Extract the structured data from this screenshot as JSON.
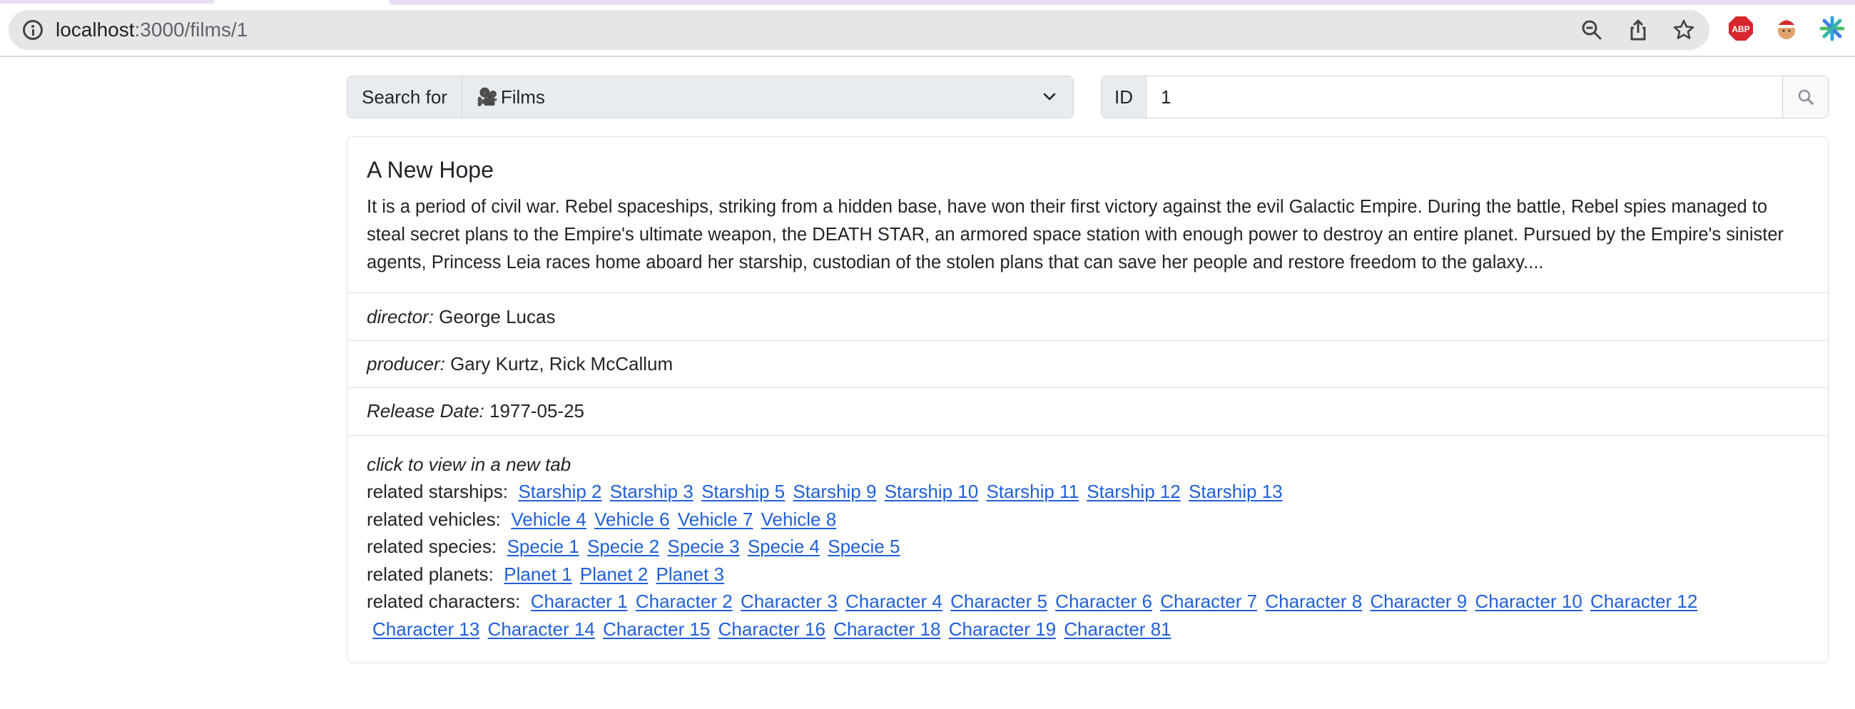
{
  "browser": {
    "url_host": "localhost",
    "url_path": ":3000/films/1",
    "extensions": [
      "abp-extension-icon",
      "santa-extension-icon",
      "sparkle-extension-icon"
    ],
    "ext_abp_label": "ABP"
  },
  "search": {
    "search_for_label": "Search for",
    "category_icon": "🎥",
    "category_value": "Films",
    "id_label": "ID",
    "id_value": "1"
  },
  "film": {
    "title": "A New Hope",
    "opening_crawl": "It is a period of civil war. Rebel spaceships, striking from a hidden base, have won their first victory against the evil Galactic Empire. During the battle, Rebel spies managed to steal secret plans to the Empire's ultimate weapon, the DEATH STAR, an armored space station with enough power to destroy an entire planet. Pursued by the Empire's sinister agents, Princess Leia races home aboard her starship, custodian of the stolen plans that can save her people and restore freedom to the galaxy....",
    "director_label": "director:",
    "director": "George Lucas",
    "producer_label": "producer:",
    "producer": "Gary Kurtz, Rick McCallum",
    "release_label": "Release Date:",
    "release_date": "1977-05-25"
  },
  "related": {
    "hint": "click to view in a new tab",
    "starships_label": "related starships:",
    "starships": [
      "Starship 2",
      "Starship 3",
      "Starship 5",
      "Starship 9",
      "Starship 10",
      "Starship 11",
      "Starship 12",
      "Starship 13"
    ],
    "vehicles_label": "related vehicles:",
    "vehicles": [
      "Vehicle 4",
      "Vehicle 6",
      "Vehicle 7",
      "Vehicle 8"
    ],
    "species_label": "related species:",
    "species": [
      "Specie 1",
      "Specie 2",
      "Specie 3",
      "Specie 4",
      "Specie 5"
    ],
    "planets_label": "related planets:",
    "planets": [
      "Planet 1",
      "Planet 2",
      "Planet 3"
    ],
    "characters_label": "related characters:",
    "characters": [
      "Character 1",
      "Character 2",
      "Character 3",
      "Character 4",
      "Character 5",
      "Character 6",
      "Character 7",
      "Character 8",
      "Character 9",
      "Character 10",
      "Character 12",
      "Character 13",
      "Character 14",
      "Character 15",
      "Character 16",
      "Character 18",
      "Character 19",
      "Character 81"
    ]
  },
  "colors": {
    "link": "#2060d8",
    "border": "#dee2e6",
    "input_group_bg": "#e9ecef"
  }
}
